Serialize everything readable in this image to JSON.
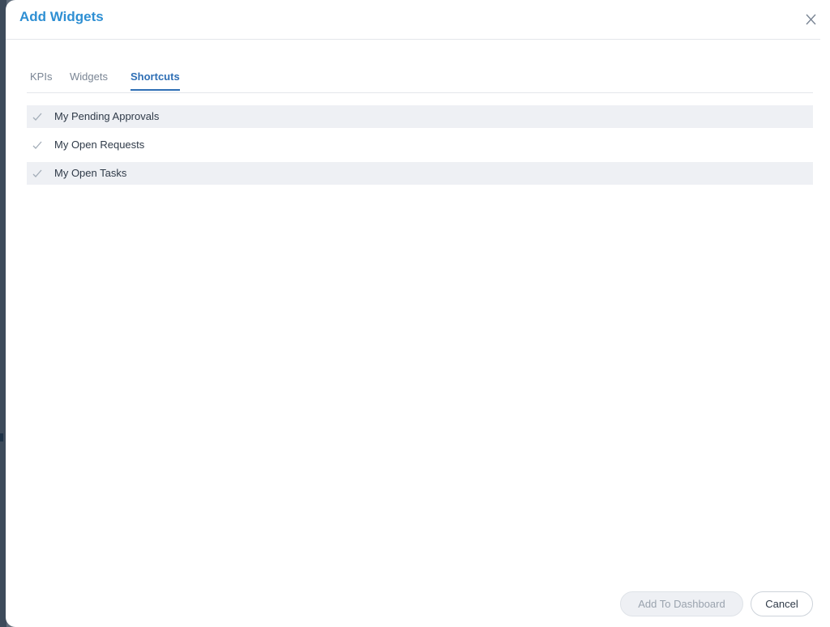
{
  "modal": {
    "title": "Add Widgets",
    "close_icon": "close-icon"
  },
  "tabs": [
    {
      "label": "KPIs",
      "active": false
    },
    {
      "label": "Widgets",
      "active": false
    },
    {
      "label": "Shortcuts",
      "active": true
    }
  ],
  "shortcuts": [
    {
      "label": "My Pending Approvals",
      "checked": true,
      "icon": "check-icon"
    },
    {
      "label": "My Open Requests",
      "checked": true,
      "icon": "check-icon"
    },
    {
      "label": "My Open Tasks",
      "checked": true,
      "icon": "check-icon"
    }
  ],
  "footer": {
    "add_label": "Add To Dashboard",
    "cancel_label": "Cancel"
  },
  "colors": {
    "title": "#2e8fd3",
    "active_tab": "#2f6fb5",
    "row_shade": "#eef0f4"
  }
}
